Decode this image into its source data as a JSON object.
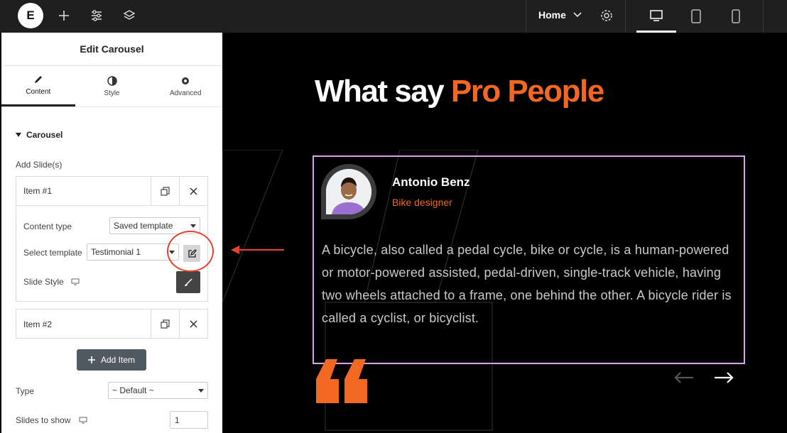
{
  "topbar": {
    "logo": "E",
    "page_name": "Home",
    "icons": [
      "plus-icon",
      "sliders-icon",
      "layers-icon",
      "chevron-down-icon",
      "gear-icon",
      "desktop-icon",
      "tablet-icon",
      "mobile-icon"
    ]
  },
  "panel": {
    "title": "Edit Carousel",
    "tabs": [
      {
        "label": "Content",
        "icon": "pencil-icon"
      },
      {
        "label": "Style",
        "icon": "contrast-icon"
      },
      {
        "label": "Advanced",
        "icon": "gear-icon"
      }
    ],
    "section": "Carousel",
    "add_slides_label": "Add Slide(s)",
    "items": [
      {
        "title": "Item #1"
      },
      {
        "title": "Item #2"
      }
    ],
    "content_type_label": "Content type",
    "content_type_value": "Saved template",
    "select_template_label": "Select template",
    "select_template_value": "Testimonial 1",
    "slide_style_label": "Slide Style",
    "add_item_label": "Add Item",
    "type_label": "Type",
    "type_value": "~ Default ~",
    "slides_to_show_label": "Slides to show",
    "slides_to_show_value": "1"
  },
  "canvas": {
    "heading_main": "What say ",
    "heading_accent": "Pro People",
    "testimonial": {
      "name": "Antonio Benz",
      "role": "Bike designer",
      "text": "A bicycle, also called a pedal cycle, bike or cycle, is a human-powered or motor-powered assisted, pedal-driven, single-track vehicle, having two wheels attached to a frame, one behind the other. A bicycle rider is called a cyclist, or bicyclist."
    }
  },
  "colors": {
    "accent": "#f26722",
    "card_border": "#d7a3e6",
    "annotation": "#e8412c"
  }
}
